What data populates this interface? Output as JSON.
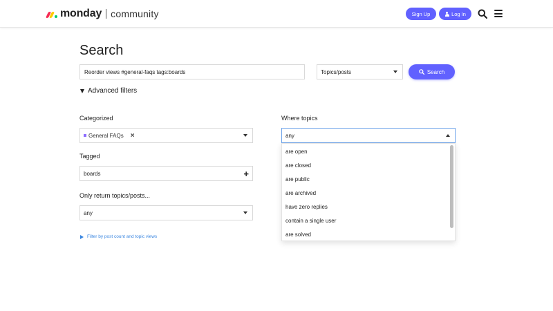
{
  "header": {
    "brand": "monday",
    "community": "community",
    "signup_label": "Sign Up",
    "login_label": "Log In"
  },
  "main": {
    "title": "Search",
    "search_query": "Reorder views #general-faqs tags:boards",
    "scope_select": "Topics/posts",
    "search_button": "Search",
    "advanced_filters": "Advanced filters",
    "categorized_label": "Categorized",
    "categorized_value": "General FAQs",
    "tagged_label": "Tagged",
    "tagged_value": "boards",
    "only_return_label": "Only return topics/posts...",
    "only_return_value": "any",
    "filter_link": "Filter by post count and topic views",
    "where_topics_label": "Where topics",
    "where_topics_value": "any",
    "where_topics_options": [
      "are open",
      "are closed",
      "are public",
      "are archived",
      "have zero replies",
      "contain a single user",
      "are solved"
    ]
  },
  "colors": {
    "accent": "#6161ff",
    "link": "#3a86e0",
    "category_square": "#8d6dff"
  }
}
